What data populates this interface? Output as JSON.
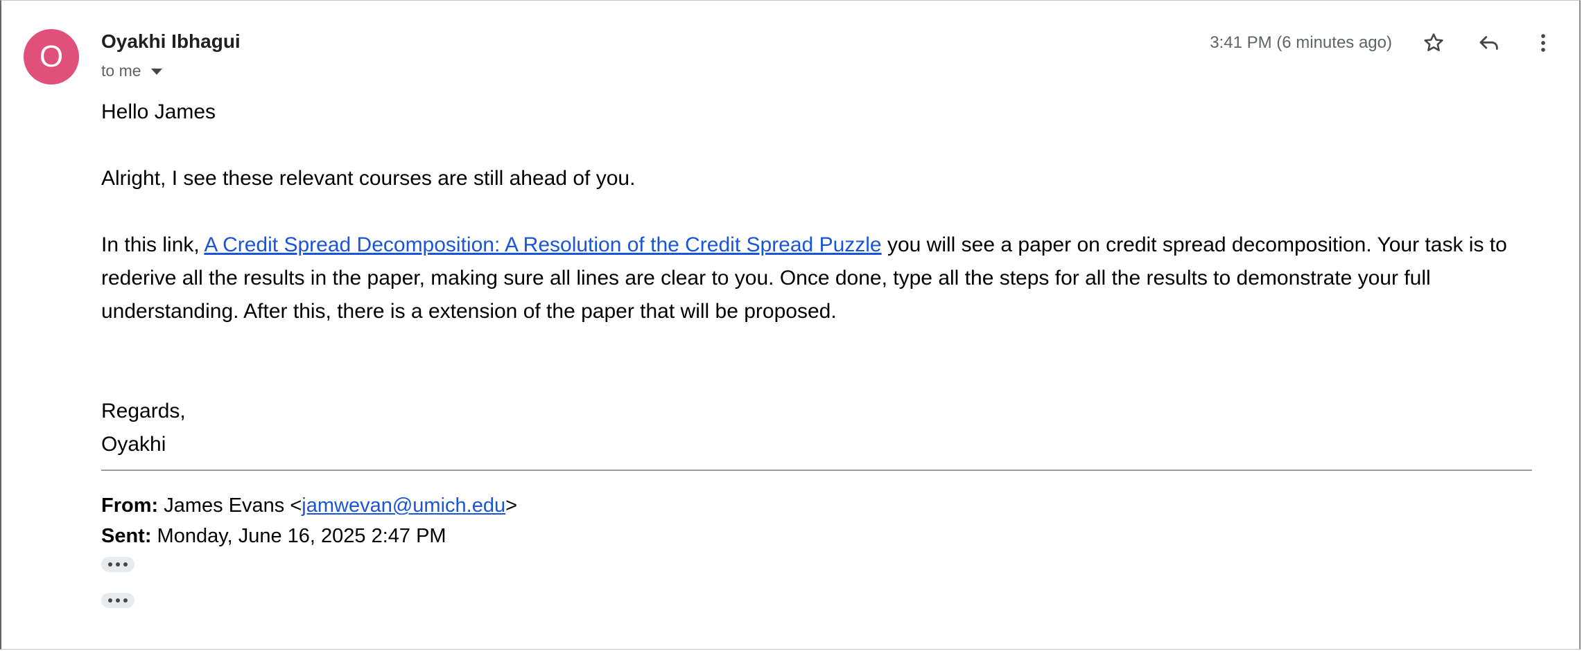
{
  "sender": {
    "avatar_letter": "O",
    "avatar_color": "#e0507a",
    "name": "Oyakhi Ibhagui",
    "recipient_label": "to me"
  },
  "header": {
    "timestamp": "3:41 PM (6 minutes ago)",
    "icons": [
      "star-icon",
      "reply-icon",
      "more-vert-icon"
    ]
  },
  "body": {
    "greeting": "Hello James",
    "paragraph1": "Alright, I see these relevant courses are still ahead of you.",
    "paragraph2_prefix": "In this link, ",
    "paragraph2_link": "A Credit Spread Decomposition: A Resolution of the Credit Spread Puzzle",
    "paragraph2_suffix": " you will see a paper on credit spread decomposition. Your task is to rederive all the results in the paper, making sure all lines are clear to you. Once done, type all the steps for all the results to demonstrate your full understanding. After this, there is a extension of the paper that will be proposed.",
    "signoff": "Regards,",
    "signature": "Oyakhi"
  },
  "quoted": {
    "from_label": "From:",
    "from_name": " James Evans <",
    "from_email": "jamwevan@umich.edu",
    "from_close": ">",
    "sent_label": "Sent:",
    "sent_value": " Monday, June 16, 2025 2:47 PM"
  },
  "colors": {
    "link": "#1a55d9",
    "muted": "#5f6368"
  }
}
